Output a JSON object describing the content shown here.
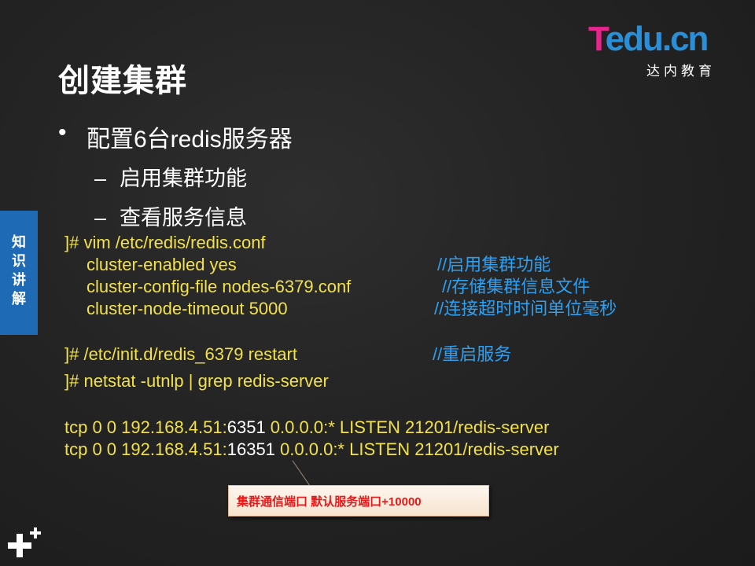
{
  "slide": {
    "title": "创建集群",
    "logo": {
      "brand_t": "T",
      "brand_rest": "edu.cn",
      "subtitle": "达内教育"
    },
    "side_tab": [
      "知",
      "识",
      "讲",
      "解"
    ],
    "bullet": {
      "symbol": "•",
      "text": "配置6台redis服务器"
    },
    "sub_items": [
      {
        "dash": "–",
        "text": "启用集群功能"
      },
      {
        "dash": "–",
        "text": "查看服务信息"
      }
    ],
    "code": {
      "vim_cmd": "]# vim  /etc/redis/redis.conf",
      "line1": "cluster-enabled  yes",
      "line1_comment": "//启用集群功能",
      "line2": "cluster-config-file  nodes-6379.conf",
      "line2_comment": "//存储集群信息文件",
      "line3": "cluster-node-timeout  5000",
      "line3_comment": "//连接超时时间单位毫秒",
      "restart_cmd": "]# /etc/init.d/redis_6379  restart",
      "restart_comment": "//重启服务",
      "netstat_cmd": "]# netstat -utnlp  | grep redis-server",
      "out1_prefix": "tcp  0  0 192.168.4.51:",
      "out1_port": "6351",
      "out1_suffix": "  0.0.0.0:*   LISTEN      21201/redis-server",
      "out2_prefix": "tcp  0  0 192.168.4.51:",
      "out2_port": "16351",
      "out2_suffix": "   0.0.0.0:*   LISTEN   21201/redis-server"
    },
    "callout": "集群通信端口 默认服务端口+10000"
  },
  "colors": {
    "background": "#242424",
    "code_text": "#f2e14a",
    "comment": "#2f9ff0",
    "side_tab": "#1e6ab4",
    "callout_text": "#e41a1a",
    "logo_pink": "#e8258f",
    "logo_blue": "#2a8fd6"
  }
}
